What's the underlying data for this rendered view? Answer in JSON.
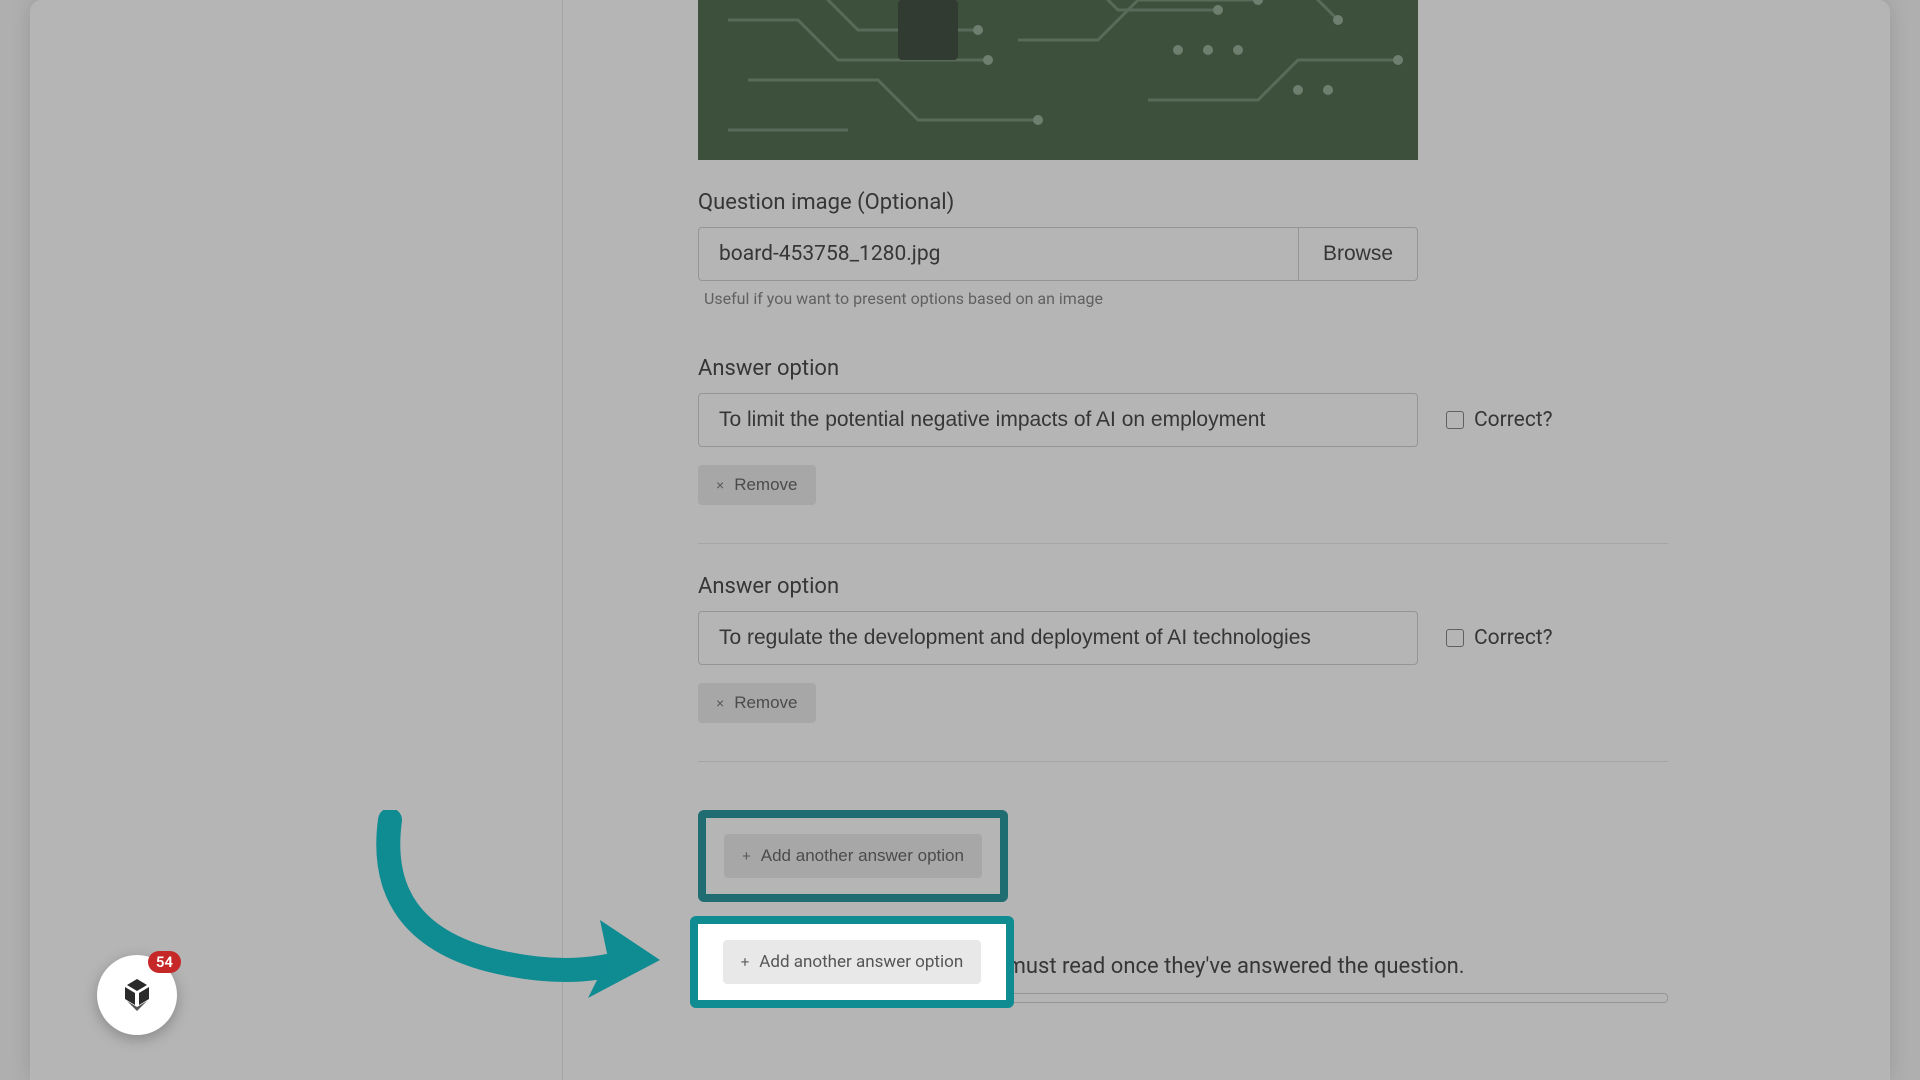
{
  "form": {
    "question_image_label": "Question image (Optional)",
    "file_name": "board-453758_1280.jpg",
    "browse_label": "Browse",
    "image_help_text": "Useful if you want to present options based on an image",
    "answer_option_label": "Answer option",
    "correct_label": "Correct?",
    "remove_label": "Remove",
    "add_option_label": "Add another answer option",
    "feedback_label": "Add any feedback that the user must read once they've answered the question.",
    "answers": [
      {
        "text": "To limit the potential negative impacts of AI on employment",
        "correct": false
      },
      {
        "text": "To regulate the development and deployment of AI technologies",
        "correct": false
      }
    ]
  },
  "chat": {
    "badge_count": "54"
  },
  "annotation": {
    "arrow_color": "#0f8b92",
    "highlight_color": "#0f8b92"
  },
  "icons": {
    "close": "×",
    "plus": "+"
  }
}
